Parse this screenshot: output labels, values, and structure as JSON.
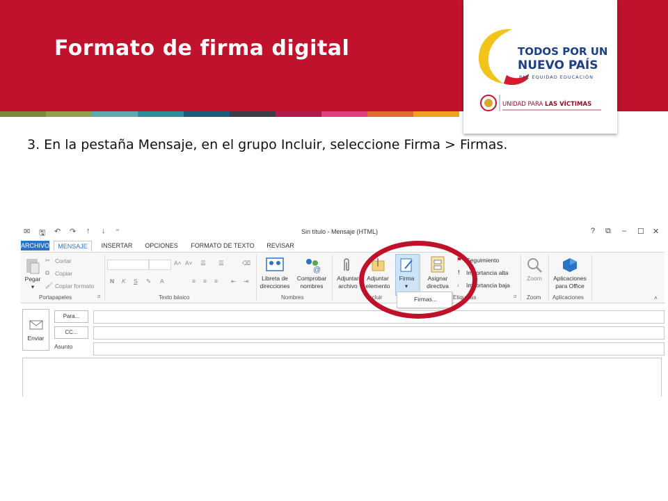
{
  "slide": {
    "title": "Formato de firma digital",
    "instruction": "3. En la pestaña Mensaje, en el grupo Incluir, seleccione Firma > Firmas."
  },
  "logo": {
    "line1": "TODOS POR UN",
    "line2": "NUEVO PAÍS",
    "tagline": "PAZ  EQUIDAD  EDUCACIÓN",
    "unit_prefix": "UNIDAD PARA",
    "unit_bold": "LAS VÍCTIMAS"
  },
  "colors": {
    "banner": "#c0122d",
    "accent_blue": "#2a74c6",
    "highlight_circle": "#c0112a",
    "stripe": [
      "#7a8a3a",
      "#8fa04a",
      "#5fa8b0",
      "#2e8f9a",
      "#1c5c78",
      "#3d3d4a",
      "#b01a4a",
      "#e04080",
      "#e06a30",
      "#f0a020"
    ]
  },
  "window": {
    "title": "Sin título - Mensaje (HTML)",
    "controls": [
      "?",
      "⧉",
      "–",
      "☐",
      "✕"
    ],
    "tabs": [
      "ARCHIVO",
      "MENSAJE",
      "INSERTAR",
      "OPCIONES",
      "FORMATO DE TEXTO",
      "REVISAR"
    ],
    "active_tab": "MENSAJE"
  },
  "ribbon": {
    "clipboard": {
      "paste": "Pegar",
      "cut": "Cortar",
      "copy": "Copiar",
      "format_painter": "Copiar formato",
      "group": "Portapapeles"
    },
    "basic_text": {
      "bold": "N",
      "italic": "K",
      "underline": "S",
      "group": "Texto básico"
    },
    "names": {
      "address_book": "Libreta de\ndirecciones",
      "check_names": "Comprobar\nnombres",
      "group": "Nombres"
    },
    "include": {
      "attach_file": "Adjuntar\narchivo",
      "attach_item": "Adjuntar\nelemento",
      "signature": "Firma",
      "group": "Incluir"
    },
    "tags": {
      "assign_policy": "Asignar\ndirectiva",
      "follow_up": "Seguimiento",
      "high_importance": "Importancia alta",
      "low_importance": "Importancia baja",
      "group": "Etiquetas"
    },
    "zoom": {
      "label": "Zoom",
      "group": "Zoom"
    },
    "apps": {
      "label": "Aplicaciones\npara Office",
      "group": "Aplicaciones"
    }
  },
  "signature_menu": {
    "item": "Firmas..."
  },
  "compose": {
    "send": "Enviar",
    "to": "Para...",
    "cc": "CC...",
    "subject": "Asunto",
    "to_value": "",
    "cc_value": "",
    "subject_value": ""
  }
}
